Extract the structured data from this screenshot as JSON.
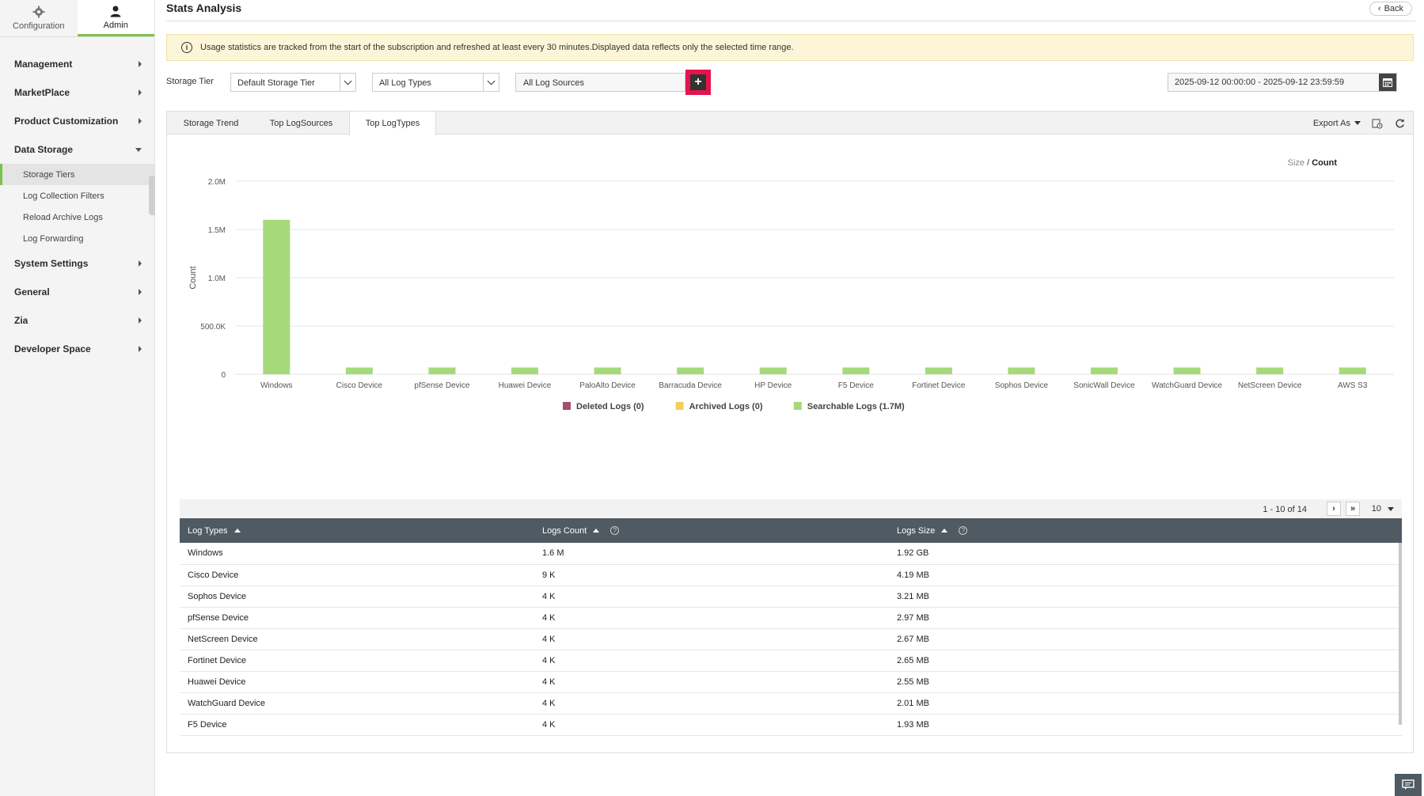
{
  "sidebar": {
    "switch": [
      {
        "label": "Configuration",
        "icon": "gear-icon"
      },
      {
        "label": "Admin",
        "icon": "user-icon"
      }
    ],
    "items": [
      {
        "label": "Management"
      },
      {
        "label": "MarketPlace"
      },
      {
        "label": "Product Customization"
      },
      {
        "label": "Data Storage"
      },
      {
        "label": "System Settings"
      },
      {
        "label": "General"
      },
      {
        "label": "Zia"
      },
      {
        "label": "Developer Space"
      }
    ],
    "sub_items": [
      "Storage Tiers",
      "Log Collection Filters",
      "Reload Archive Logs",
      "Log Forwarding"
    ]
  },
  "header": {
    "title": "Stats Analysis",
    "back_label": "Back"
  },
  "info": {
    "text": "Usage statistics are tracked from the start of the subscription and refreshed at least every 30 minutes.Displayed data reflects only the selected time range."
  },
  "filters": {
    "storage_tier_label": "Storage Tier",
    "storage_tier_value": "Default Storage Tier",
    "log_types_value": "All Log Types",
    "log_sources_value": "All Log Sources",
    "date_range": "2025-09-12 00:00:00 - 2025-09-12 23:59:59"
  },
  "tabs": [
    "Storage Trend",
    "Top LogSources",
    "Top LogTypes"
  ],
  "tools": {
    "export_label": "Export As"
  },
  "toggle": {
    "size": "Size",
    "sep": " / ",
    "count": "Count"
  },
  "chart_data": {
    "type": "bar",
    "ylabel": "Count",
    "ylim": [
      0,
      2000000
    ],
    "y_ticks": [
      "0",
      "500.0K",
      "1.0M",
      "1.5M",
      "2.0M"
    ],
    "categories": [
      "Windows",
      "Cisco Device",
      "pfSense Device",
      "Huawei Device",
      "PaloAlto Device",
      "Barracuda Device",
      "HP Device",
      "F5 Device",
      "Fortinet Device",
      "Sophos Device",
      "SonicWall Device",
      "WatchGuard Device",
      "NetScreen Device",
      "AWS S3"
    ],
    "series": [
      {
        "name": "Searchable Logs (1.7M)",
        "color": "#a6d97a",
        "values": [
          1600000,
          70000,
          70000,
          70000,
          70000,
          70000,
          70000,
          70000,
          70000,
          70000,
          70000,
          70000,
          70000,
          70000
        ]
      }
    ],
    "legend": [
      {
        "label": "Deleted Logs (0)",
        "color": "#a0526a"
      },
      {
        "label": "Archived Logs (0)",
        "color": "#f2d060"
      },
      {
        "label": "Searchable Logs (1.7M)",
        "color": "#a6d97a"
      }
    ],
    "grid": true
  },
  "pager": {
    "info": "1 - 10 of 14",
    "page_size": "10"
  },
  "table": {
    "headers": [
      "Log Types",
      "Logs Count",
      "Logs Size"
    ],
    "rows": [
      [
        "Windows",
        "1.6 M",
        "1.92 GB"
      ],
      [
        "Cisco Device",
        "9 K",
        "4.19 MB"
      ],
      [
        "Sophos Device",
        "4 K",
        "3.21 MB"
      ],
      [
        "pfSense Device",
        "4 K",
        "2.97 MB"
      ],
      [
        "NetScreen Device",
        "4 K",
        "2.67 MB"
      ],
      [
        "Fortinet Device",
        "4 K",
        "2.65 MB"
      ],
      [
        "Huawei Device",
        "4 K",
        "2.55 MB"
      ],
      [
        "WatchGuard Device",
        "4 K",
        "2.01 MB"
      ],
      [
        "F5 Device",
        "4 K",
        "1.93 MB"
      ]
    ]
  }
}
